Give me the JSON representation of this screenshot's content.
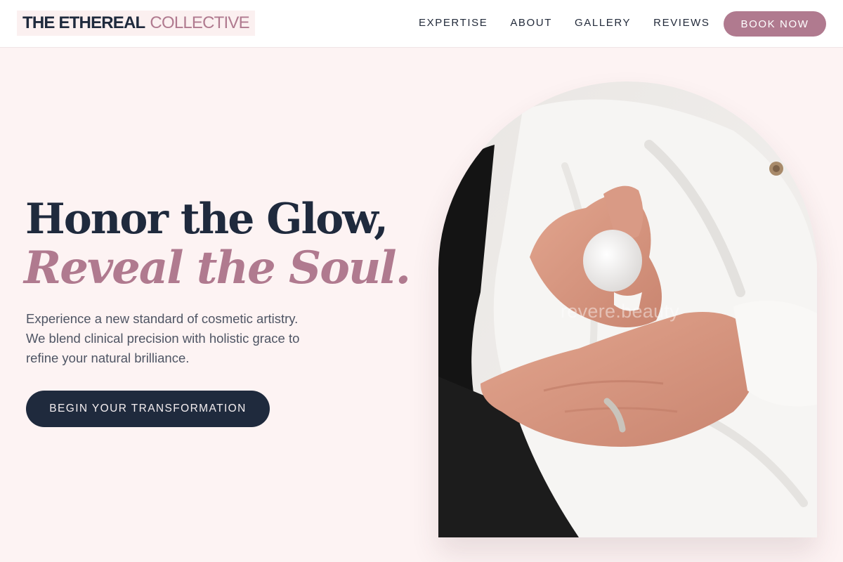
{
  "brand": {
    "name_main": "THE ETHEREAL",
    "name_accent": "COLLECTIVE"
  },
  "nav": {
    "items": [
      {
        "label": "EXPERTISE"
      },
      {
        "label": "ABOUT"
      },
      {
        "label": "GALLERY"
      },
      {
        "label": "REVIEWS"
      }
    ],
    "cta_label": "BOOK NOW"
  },
  "hero": {
    "headline_line1": "Honor the Glow,",
    "headline_line2": "Reveal the Soul.",
    "subtext_lines": [
      "Experience a new standard of cosmetic artistry.",
      "We blend clinical precision with holistic grace to",
      "refine your natural brilliance."
    ],
    "cta_label": "BEGIN YOUR TRANSFORMATION"
  },
  "image": {
    "watermark": "revere.beauty"
  },
  "colors": {
    "navy": "#1f2a3d",
    "mauve": "#b07a8f",
    "blush_bg": "#fdf3f3",
    "white": "#ffffff"
  }
}
